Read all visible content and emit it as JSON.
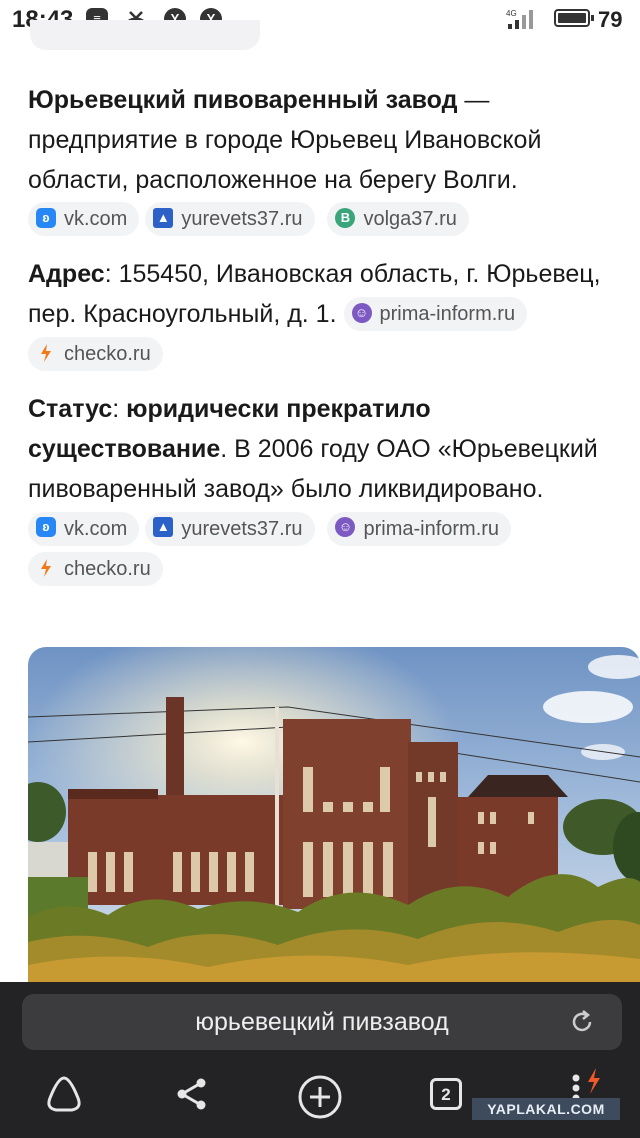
{
  "status_bar": {
    "time": "18:43",
    "network": "4G",
    "battery": "79",
    "icons": [
      "message-icon",
      "missed-call-icon",
      "yandex-icon",
      "yandex-icon"
    ]
  },
  "article": {
    "p1": {
      "bold": "Юрьевецкий пивоваренный завод",
      "text": " — предприятие в городе Юрьевец Ивановской области, расположенное на берегу Волги.",
      "sources": [
        "vk.com",
        "yurevets37.ru",
        "volga37.ru"
      ]
    },
    "p2": {
      "label": "Адрес",
      "text": ": 155450, Ивановская область, г. Юрьевец, пер. Красноугольный, д. 1.",
      "sources": [
        "prima-inform.ru",
        "checko.ru"
      ]
    },
    "p3": {
      "label": "Статус",
      "colon": ": ",
      "bold": "юридически прекратило существование",
      "text": ". В 2006 году ОАО «Юрьевецкий пивоваренный завод» было ликвидировано.",
      "sources": [
        "vk.com",
        "yurevets37.ru",
        "prima-inform.ru",
        "checko.ru"
      ]
    }
  },
  "image": {
    "subject": "brick-brewery-photo"
  },
  "bottom_bar": {
    "search_query": "юрьевецкий пивзавод",
    "tabs_count": "2"
  },
  "watermark": "YAPLAKAL.COM",
  "colors": {
    "vk": "#2787f5",
    "bar_bg": "#232325",
    "search_bg": "#3c3c3f",
    "chip_bg": "#f2f3f5"
  }
}
